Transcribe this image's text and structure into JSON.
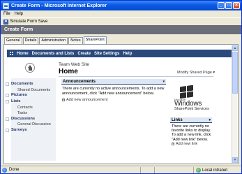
{
  "window": {
    "title": "Create Form - Microsoft Internet Explorer",
    "controls": {
      "minimize": "_",
      "maximize": "□",
      "close": "×"
    }
  },
  "menu": {
    "items": [
      "File",
      "Help"
    ]
  },
  "toolbar": {
    "simulate_label": "Simulate Form Save"
  },
  "form_header": {
    "title": "Create Form"
  },
  "tabs": [
    "General",
    "Details",
    "Administration",
    "Notes",
    "SharePoint"
  ],
  "active_tab": "SharePoint",
  "sharepoint": {
    "nav": [
      "Home",
      "Documents and Lists",
      "Create",
      "Site Settings",
      "Help"
    ],
    "site_title": "Team Web Site",
    "page_title": "Home",
    "modify_link": "Modify Shared Page ▾",
    "quick_launch": {
      "documents": "Documents",
      "shared_documents": "Shared Documents",
      "pictures": "Pictures",
      "lists": "Lists",
      "contacts": "Contacts",
      "tasks": "Tasks",
      "discussions": "Discussions",
      "general_discussion": "General Discussion",
      "surveys": "Surveys"
    },
    "announcements": {
      "title": "Announcements",
      "arrow": "▾",
      "text": "There are currently no active announcements. To add a new announcement, click \"Add new announcement\" below.",
      "add_label": "Add new announcement"
    },
    "logo": {
      "microsoft": "Microsoft",
      "windows": "Windows",
      "product": "SharePoint Services"
    },
    "links": {
      "title": "Links",
      "arrow": "▾",
      "text": "There are currently no favorite links to display. To add a new link, click \"Add new link\" below.",
      "add_label": "Add new link"
    }
  },
  "status": {
    "text": "Done",
    "zone": "Local intranet"
  },
  "colors": {
    "titlebar": "#0a5ae3",
    "sp_nav": "#2a4a7e",
    "form_header": "#6b6e79"
  },
  "icons": {
    "app": "ie-document-icon",
    "save": "save-icon",
    "home": "house-icon",
    "zone": "intranet-zone-icon"
  }
}
